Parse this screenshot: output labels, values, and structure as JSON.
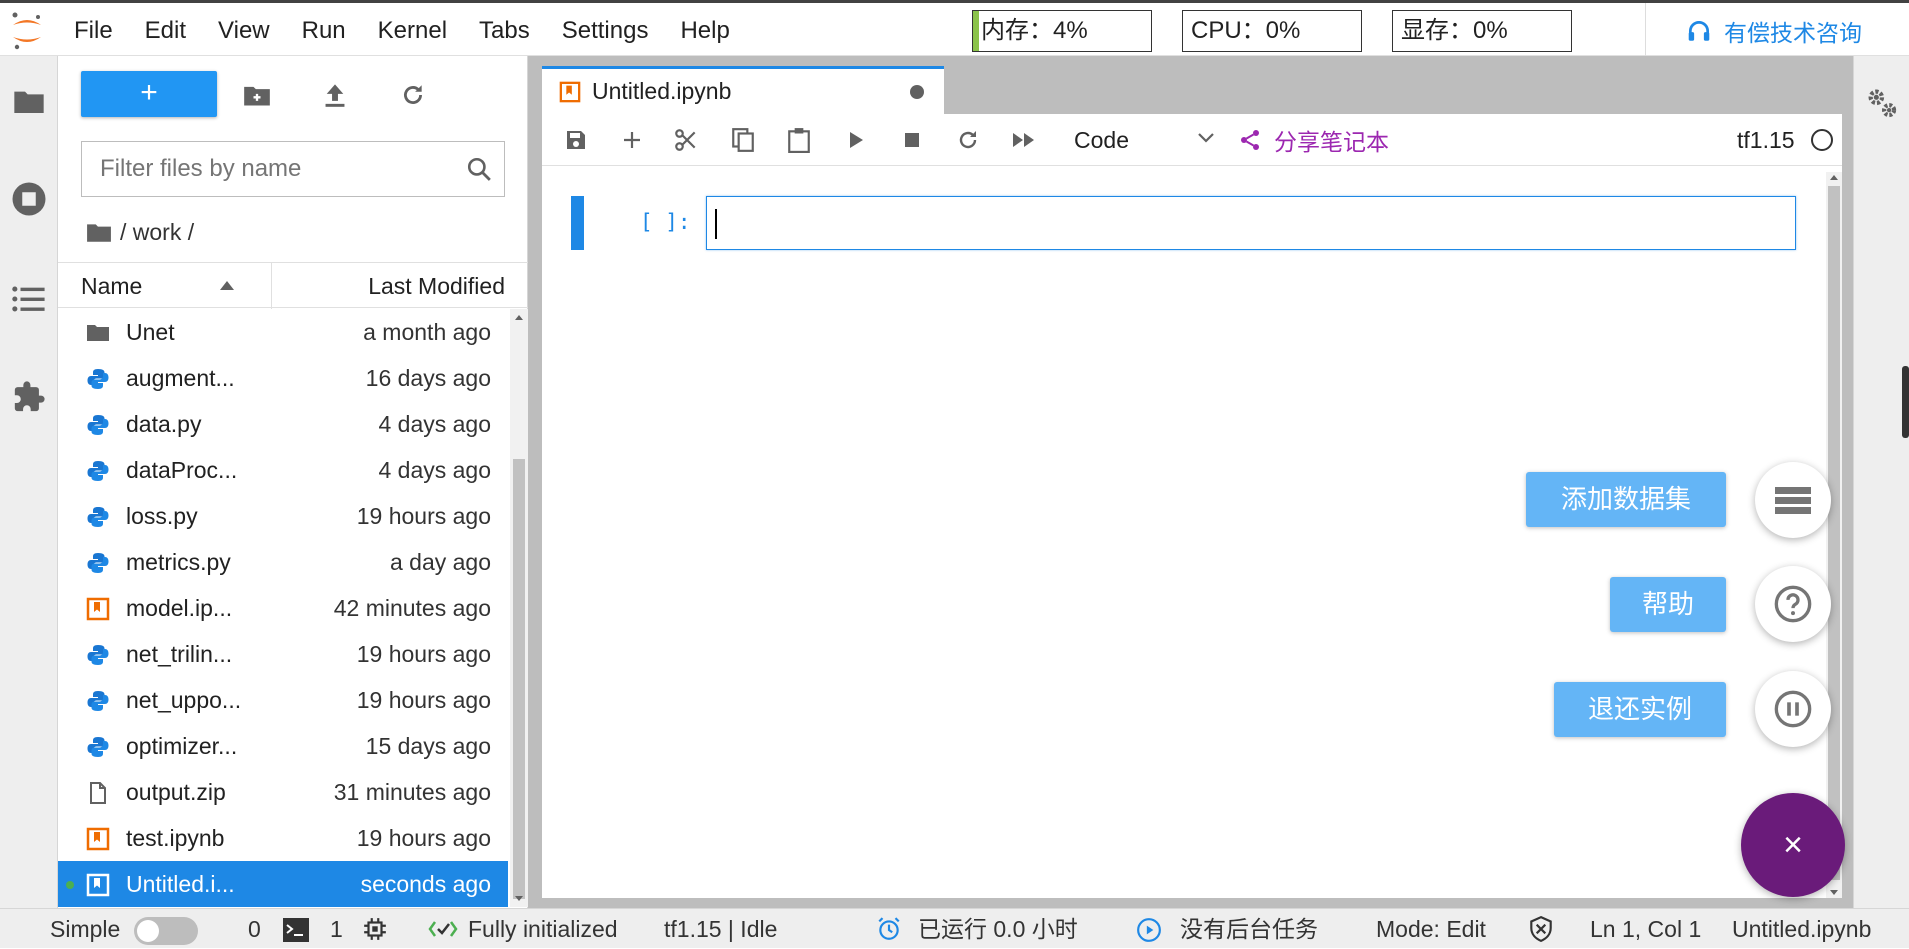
{
  "menu": {
    "items": [
      "File",
      "Edit",
      "View",
      "Run",
      "Kernel",
      "Tabs",
      "Settings",
      "Help"
    ]
  },
  "metrics": {
    "memory": "内存：4%",
    "memory_fraction": 0.04,
    "cpu": "CPU：0%",
    "gpu": "显存：0%"
  },
  "consult": {
    "label": "有偿技术咨询",
    "icon": "headset-icon"
  },
  "filebrowser": {
    "new_label": "+",
    "filter_placeholder": "Filter files by name",
    "breadcrumb": "/ work /",
    "columns": {
      "name": "Name",
      "modified": "Last Modified"
    },
    "files": [
      {
        "name": "Unet",
        "modified": "a month ago",
        "type": "folder"
      },
      {
        "name": "augment...",
        "modified": "16 days ago",
        "type": "python"
      },
      {
        "name": "data.py",
        "modified": "4 days ago",
        "type": "python"
      },
      {
        "name": "dataProc...",
        "modified": "4 days ago",
        "type": "python"
      },
      {
        "name": "loss.py",
        "modified": "19 hours ago",
        "type": "python"
      },
      {
        "name": "metrics.py",
        "modified": "a day ago",
        "type": "python"
      },
      {
        "name": "model.ip...",
        "modified": "42 minutes ago",
        "type": "notebook"
      },
      {
        "name": "net_trilin...",
        "modified": "19 hours ago",
        "type": "python"
      },
      {
        "name": "net_uppo...",
        "modified": "19 hours ago",
        "type": "python"
      },
      {
        "name": "optimizer...",
        "modified": "15 days ago",
        "type": "python"
      },
      {
        "name": "output.zip",
        "modified": "31 minutes ago",
        "type": "file"
      },
      {
        "name": "test.ipynb",
        "modified": "19 hours ago",
        "type": "notebook"
      },
      {
        "name": "Untitled.i...",
        "modified": "seconds ago",
        "type": "notebook-running"
      }
    ]
  },
  "tab": {
    "title": "Untitled.ipynb"
  },
  "notebook": {
    "cell_type": "Code",
    "share_label": "分享笔记本",
    "kernel_name": "tf1.15",
    "prompt": "[ ]:",
    "cell_text": ""
  },
  "float_actions": {
    "add_dataset": "添加数据集",
    "help": "帮助",
    "return_instance": "退还实例",
    "close": "×"
  },
  "status": {
    "mode_label": "Simple",
    "terminals_count": "0",
    "kernels_count": "1",
    "init_status": "Fully initialized",
    "kernel_status": "tf1.15 | Idle",
    "runtime": "已运行 0.0 小时",
    "background_tasks": "没有后台任务",
    "edit_mode": "Mode: Edit",
    "cursor_pos": "Ln 1, Col 1",
    "filename": "Untitled.ipynb"
  }
}
